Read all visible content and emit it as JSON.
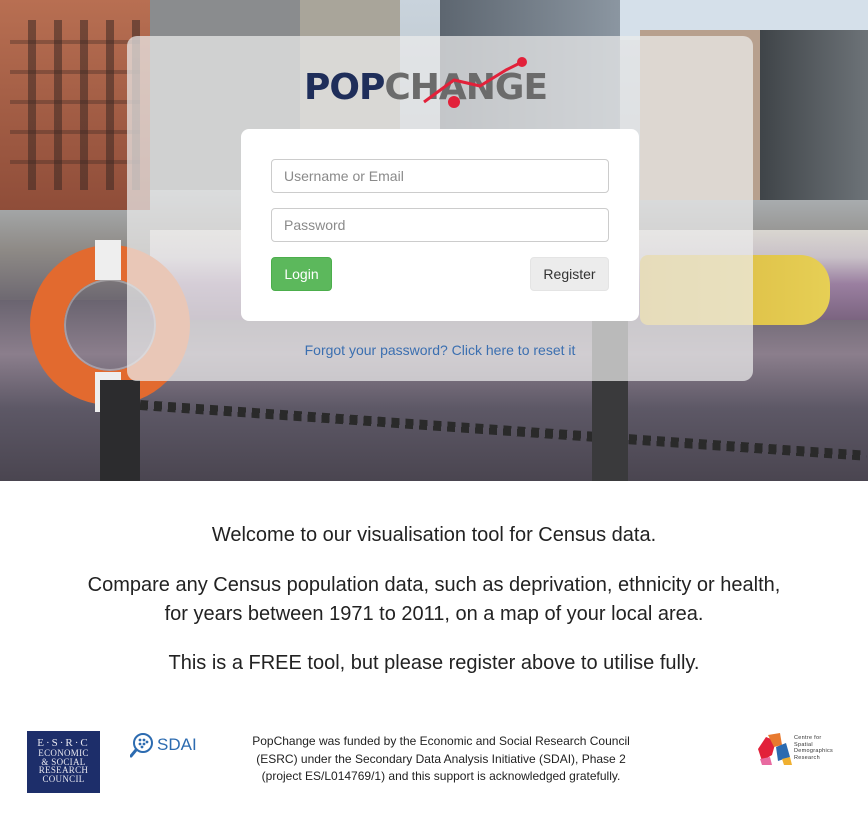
{
  "brand": {
    "logo_part1": "POP",
    "logo_part2": "CHANGE",
    "colors": {
      "navy": "#1f2e5a",
      "grey": "#6b6b6b",
      "red": "#e2213a"
    }
  },
  "login": {
    "username_placeholder": "Username or Email",
    "password_placeholder": "Password",
    "login_label": "Login",
    "register_label": "Register",
    "forgot_link": "Forgot your password? Click here to reset it",
    "colors": {
      "login_bg": "#5cb85c",
      "link": "#3b6fb0"
    }
  },
  "welcome": {
    "line1": "Welcome to our visualisation tool for Census data.",
    "line2a": "Compare any Census population data, such as deprivation, ethnicity or health,",
    "line2b": "for years between 1971 to 2011, on a map of your local area.",
    "line3": "This is a FREE tool, but please register above to utilise fully."
  },
  "footer": {
    "esrc_top": "E·S·R·C",
    "esrc_lines": [
      "ECONOMIC",
      "& SOCIAL",
      "RESEARCH",
      "COUNCIL"
    ],
    "sdai_label": "SDAI",
    "funding_line1": "PopChange was funded by the Economic and Social Research Council",
    "funding_line2": "(ESRC) under the Secondary Data Analysis Initiative (SDAI), Phase 2",
    "funding_line3": "(project ES/L014769/1) and this support is acknowledged gratefully.",
    "csdr_lines": [
      "Centre for",
      "Spatial",
      "Demographics",
      "Research"
    ]
  }
}
